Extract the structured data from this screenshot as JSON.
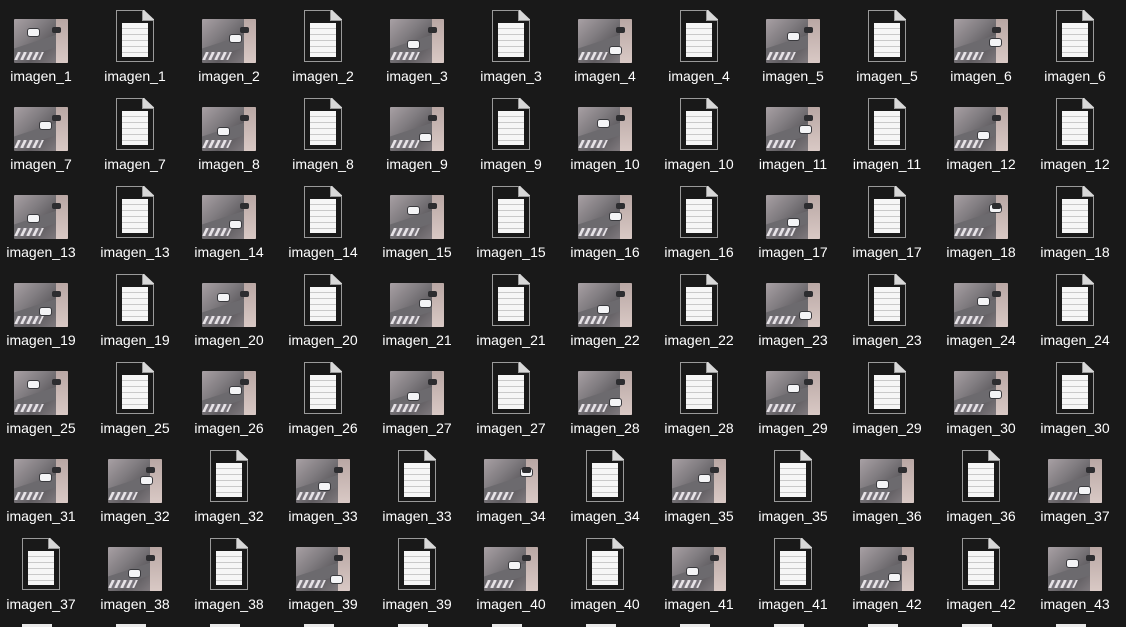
{
  "explorer": {
    "rows": [
      [
        "imagen_1",
        "imagen_1",
        "imagen_2",
        "imagen_2",
        "imagen_3",
        "imagen_3",
        "imagen_4",
        "imagen_4",
        "imagen_5",
        "imagen_5",
        "imagen_6",
        "imagen_6"
      ],
      [
        "imagen_7",
        "imagen_7",
        "imagen_8",
        "imagen_8",
        "imagen_9",
        "imagen_9",
        "imagen_10",
        "imagen_10",
        "imagen_11",
        "imagen_11",
        "imagen_12",
        "imagen_12"
      ],
      [
        "imagen_13",
        "imagen_13",
        "imagen_14",
        "imagen_14",
        "imagen_15",
        "imagen_15",
        "imagen_16",
        "imagen_16",
        "imagen_17",
        "imagen_17",
        "imagen_18",
        "imagen_18"
      ],
      [
        "imagen_19",
        "imagen_19",
        "imagen_20",
        "imagen_20",
        "imagen_21",
        "imagen_21",
        "imagen_22",
        "imagen_22",
        "imagen_23",
        "imagen_23",
        "imagen_24",
        "imagen_24"
      ],
      [
        "imagen_25",
        "imagen_25",
        "imagen_26",
        "imagen_26",
        "imagen_27",
        "imagen_27",
        "imagen_28",
        "imagen_28",
        "imagen_29",
        "imagen_29",
        "imagen_30",
        "imagen_30"
      ],
      [
        "imagen_31",
        "imagen_32",
        "imagen_32",
        "imagen_33",
        "imagen_33",
        "imagen_34",
        "imagen_34",
        "imagen_35",
        "imagen_35",
        "imagen_36",
        "imagen_36",
        "imagen_37"
      ],
      [
        "imagen_37",
        "imagen_38",
        "imagen_38",
        "imagen_39",
        "imagen_39",
        "imagen_40",
        "imagen_40",
        "imagen_41",
        "imagen_41",
        "imagen_42",
        "imagen_42",
        "imagen_43"
      ]
    ],
    "row_types": [
      [
        "image",
        "doc",
        "image",
        "doc",
        "image",
        "doc",
        "image",
        "doc",
        "image",
        "doc",
        "image",
        "doc"
      ],
      [
        "image",
        "doc",
        "image",
        "doc",
        "image",
        "doc",
        "image",
        "doc",
        "image",
        "doc",
        "image",
        "doc"
      ],
      [
        "image",
        "doc",
        "image",
        "doc",
        "image",
        "doc",
        "image",
        "doc",
        "image",
        "doc",
        "image",
        "doc"
      ],
      [
        "image",
        "doc",
        "image",
        "doc",
        "image",
        "doc",
        "image",
        "doc",
        "image",
        "doc",
        "image",
        "doc"
      ],
      [
        "image",
        "doc",
        "image",
        "doc",
        "image",
        "doc",
        "image",
        "doc",
        "image",
        "doc",
        "image",
        "doc"
      ],
      [
        "image",
        "image",
        "doc",
        "image",
        "doc",
        "image",
        "doc",
        "image",
        "doc",
        "image",
        "doc",
        "image"
      ],
      [
        "doc",
        "image",
        "doc",
        "image",
        "doc",
        "image",
        "doc",
        "image",
        "doc",
        "image",
        "doc",
        "image"
      ]
    ],
    "partial_row_types": [
      "doc",
      "doc",
      "doc",
      "doc",
      "doc",
      "doc",
      "doc",
      "doc",
      "doc",
      "doc",
      "doc",
      "doc"
    ],
    "icons": {
      "image": "image-thumbnail-icon",
      "doc": "text-document-icon"
    },
    "colors": {
      "background": "#191919",
      "label": "#ffffff"
    }
  }
}
